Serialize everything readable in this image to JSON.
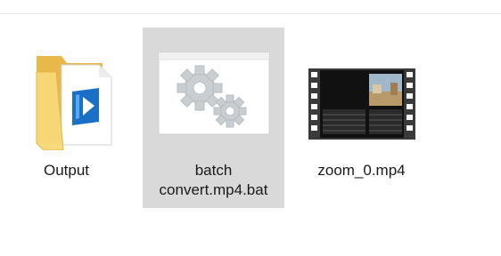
{
  "explorer": {
    "items": [
      {
        "label": "Output",
        "type": "folder",
        "icon": "folder-icon",
        "selected": false
      },
      {
        "label": "batch\nconvert.mp4.bat",
        "type": "batch-file",
        "icon": "batch-file-gears-icon",
        "selected": true
      },
      {
        "label": "zoom_0.mp4",
        "type": "video",
        "icon": "video-thumbnail-icon",
        "selected": false
      }
    ]
  },
  "colors": {
    "selection": "#d9d9d9",
    "folder": "#f6d472",
    "folder_dark": "#e9b84a",
    "media_blue": "#1a6fc7"
  }
}
